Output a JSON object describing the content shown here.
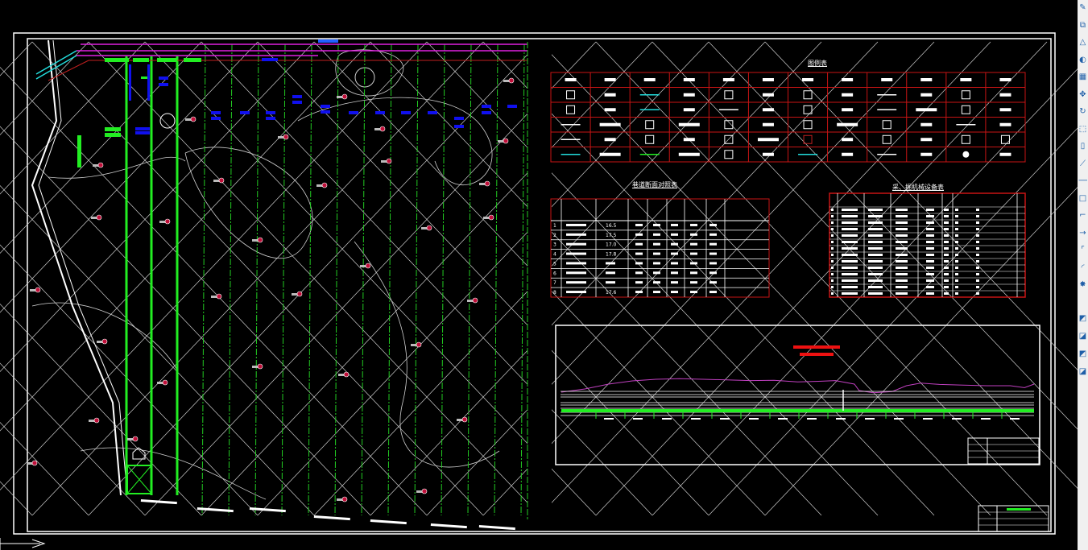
{
  "drawing": {
    "background": "#000000",
    "colors": {
      "frame": "#ffffff",
      "table_border": "#c81414",
      "roadway": "#22ee22",
      "roadway_dashed": "#22cc22",
      "grid": "#cfcfcf",
      "equipment": "#1010ee",
      "pipeline_magenta": "#e020e0",
      "pipeline_cyan": "#22dddd",
      "borehole": "#c0103a",
      "profile_curve": "#c040c0",
      "profile_title": "#ee1111"
    }
  },
  "legend_table": {
    "title": "图例表",
    "columns": 12,
    "rows": 6,
    "symbols": [
      "corner-bracket",
      "bar",
      "cyan-arrow",
      "bar",
      "winch",
      "bar",
      "bell",
      "bar",
      "dashed-line",
      "bar",
      "circle-target",
      "bar",
      "diamond",
      "bar",
      "cyan-arrow-dot",
      "bar",
      "cross-line",
      "bar",
      "double-circle",
      "bar",
      "incline",
      "long-bar",
      "double-bar",
      "bar",
      "line-dot",
      "long-bar",
      "grate",
      "long-bar",
      "double-ring",
      "bar",
      "bell",
      "long-bar",
      "hook",
      "bar",
      "double-line",
      "bar",
      "line-valve",
      "bar",
      "ladder",
      "bar",
      "cart",
      "long-bar",
      "red-p",
      "bar",
      "i-beam",
      "bar",
      "dots",
      "triple-bar",
      "cyan-arrow",
      "long-bar",
      "green-arrow",
      "long-bar",
      "bomb",
      "bar",
      "cyan-cross-arrow",
      "bar",
      "tick-line",
      "bar",
      "filled-circle",
      "bar"
    ]
  },
  "section_table": {
    "title": "巷道断面对照表",
    "row_numbers": [
      "1",
      "2",
      "3",
      "4",
      "5",
      "6",
      "7",
      "8"
    ],
    "area_values": [
      "16.5",
      "17.5",
      "17.0",
      "17.8",
      "",
      "",
      "",
      "17.6"
    ]
  },
  "equipment_table": {
    "title": "采、掘机械设备表",
    "row_count": 14
  },
  "profile": {
    "curve": [
      [
        0,
        80
      ],
      [
        5,
        70
      ],
      [
        10,
        55
      ],
      [
        15,
        45
      ],
      [
        20,
        40
      ],
      [
        25,
        38
      ],
      [
        30,
        40
      ],
      [
        35,
        42
      ],
      [
        40,
        44
      ],
      [
        45,
        43
      ],
      [
        50,
        48
      ],
      [
        55,
        46
      ],
      [
        58,
        44
      ],
      [
        62,
        55
      ],
      [
        63,
        75
      ],
      [
        66,
        82
      ],
      [
        70,
        78
      ],
      [
        73,
        60
      ],
      [
        76,
        52
      ],
      [
        80,
        56
      ],
      [
        85,
        58
      ],
      [
        90,
        60
      ],
      [
        95,
        60
      ],
      [
        98,
        66
      ],
      [
        100,
        55
      ]
    ]
  },
  "toolbar": {
    "tools": [
      {
        "name": "erase",
        "glyph": "✎"
      },
      {
        "name": "copy",
        "glyph": "⧉"
      },
      {
        "name": "mirror",
        "glyph": "△"
      },
      {
        "name": "offset",
        "glyph": "◐"
      },
      {
        "name": "array",
        "glyph": "▦"
      },
      {
        "name": "move",
        "glyph": "✥"
      },
      {
        "name": "rotate",
        "glyph": "↻"
      },
      {
        "name": "scale",
        "glyph": "⬚"
      },
      {
        "name": "stretch",
        "glyph": "▯"
      },
      {
        "name": "trim",
        "glyph": "⟋"
      },
      {
        "name": "extend",
        "glyph": "⟶"
      },
      {
        "name": "break-at-point",
        "glyph": "□"
      },
      {
        "name": "break",
        "glyph": "⌐"
      },
      {
        "name": "join",
        "glyph": "→"
      },
      {
        "name": "chamfer",
        "glyph": "⌜"
      },
      {
        "name": "fillet",
        "glyph": "◜"
      },
      {
        "name": "explode",
        "glyph": "✸"
      },
      {
        "name": "draw-order-front",
        "glyph": "◩"
      },
      {
        "name": "draw-order-back",
        "glyph": "◪"
      },
      {
        "name": "draw-order-above",
        "glyph": "◩"
      },
      {
        "name": "draw-order-under",
        "glyph": "◪"
      }
    ]
  }
}
